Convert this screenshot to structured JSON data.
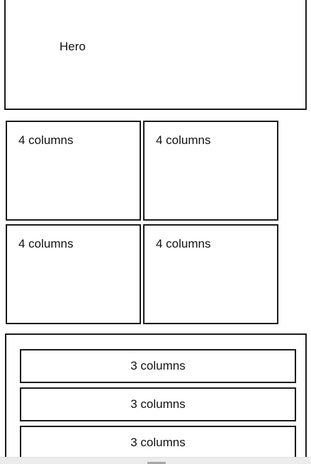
{
  "hero": {
    "label": "Hero"
  },
  "grid4": {
    "cells": [
      {
        "label": "4 columns"
      },
      {
        "label": "4 columns"
      },
      {
        "label": "4 columns"
      },
      {
        "label": "4 columns"
      }
    ]
  },
  "grid3": {
    "rows": [
      {
        "label": "3 columns"
      },
      {
        "label": "3 columns"
      },
      {
        "label": "3 columns"
      }
    ]
  }
}
